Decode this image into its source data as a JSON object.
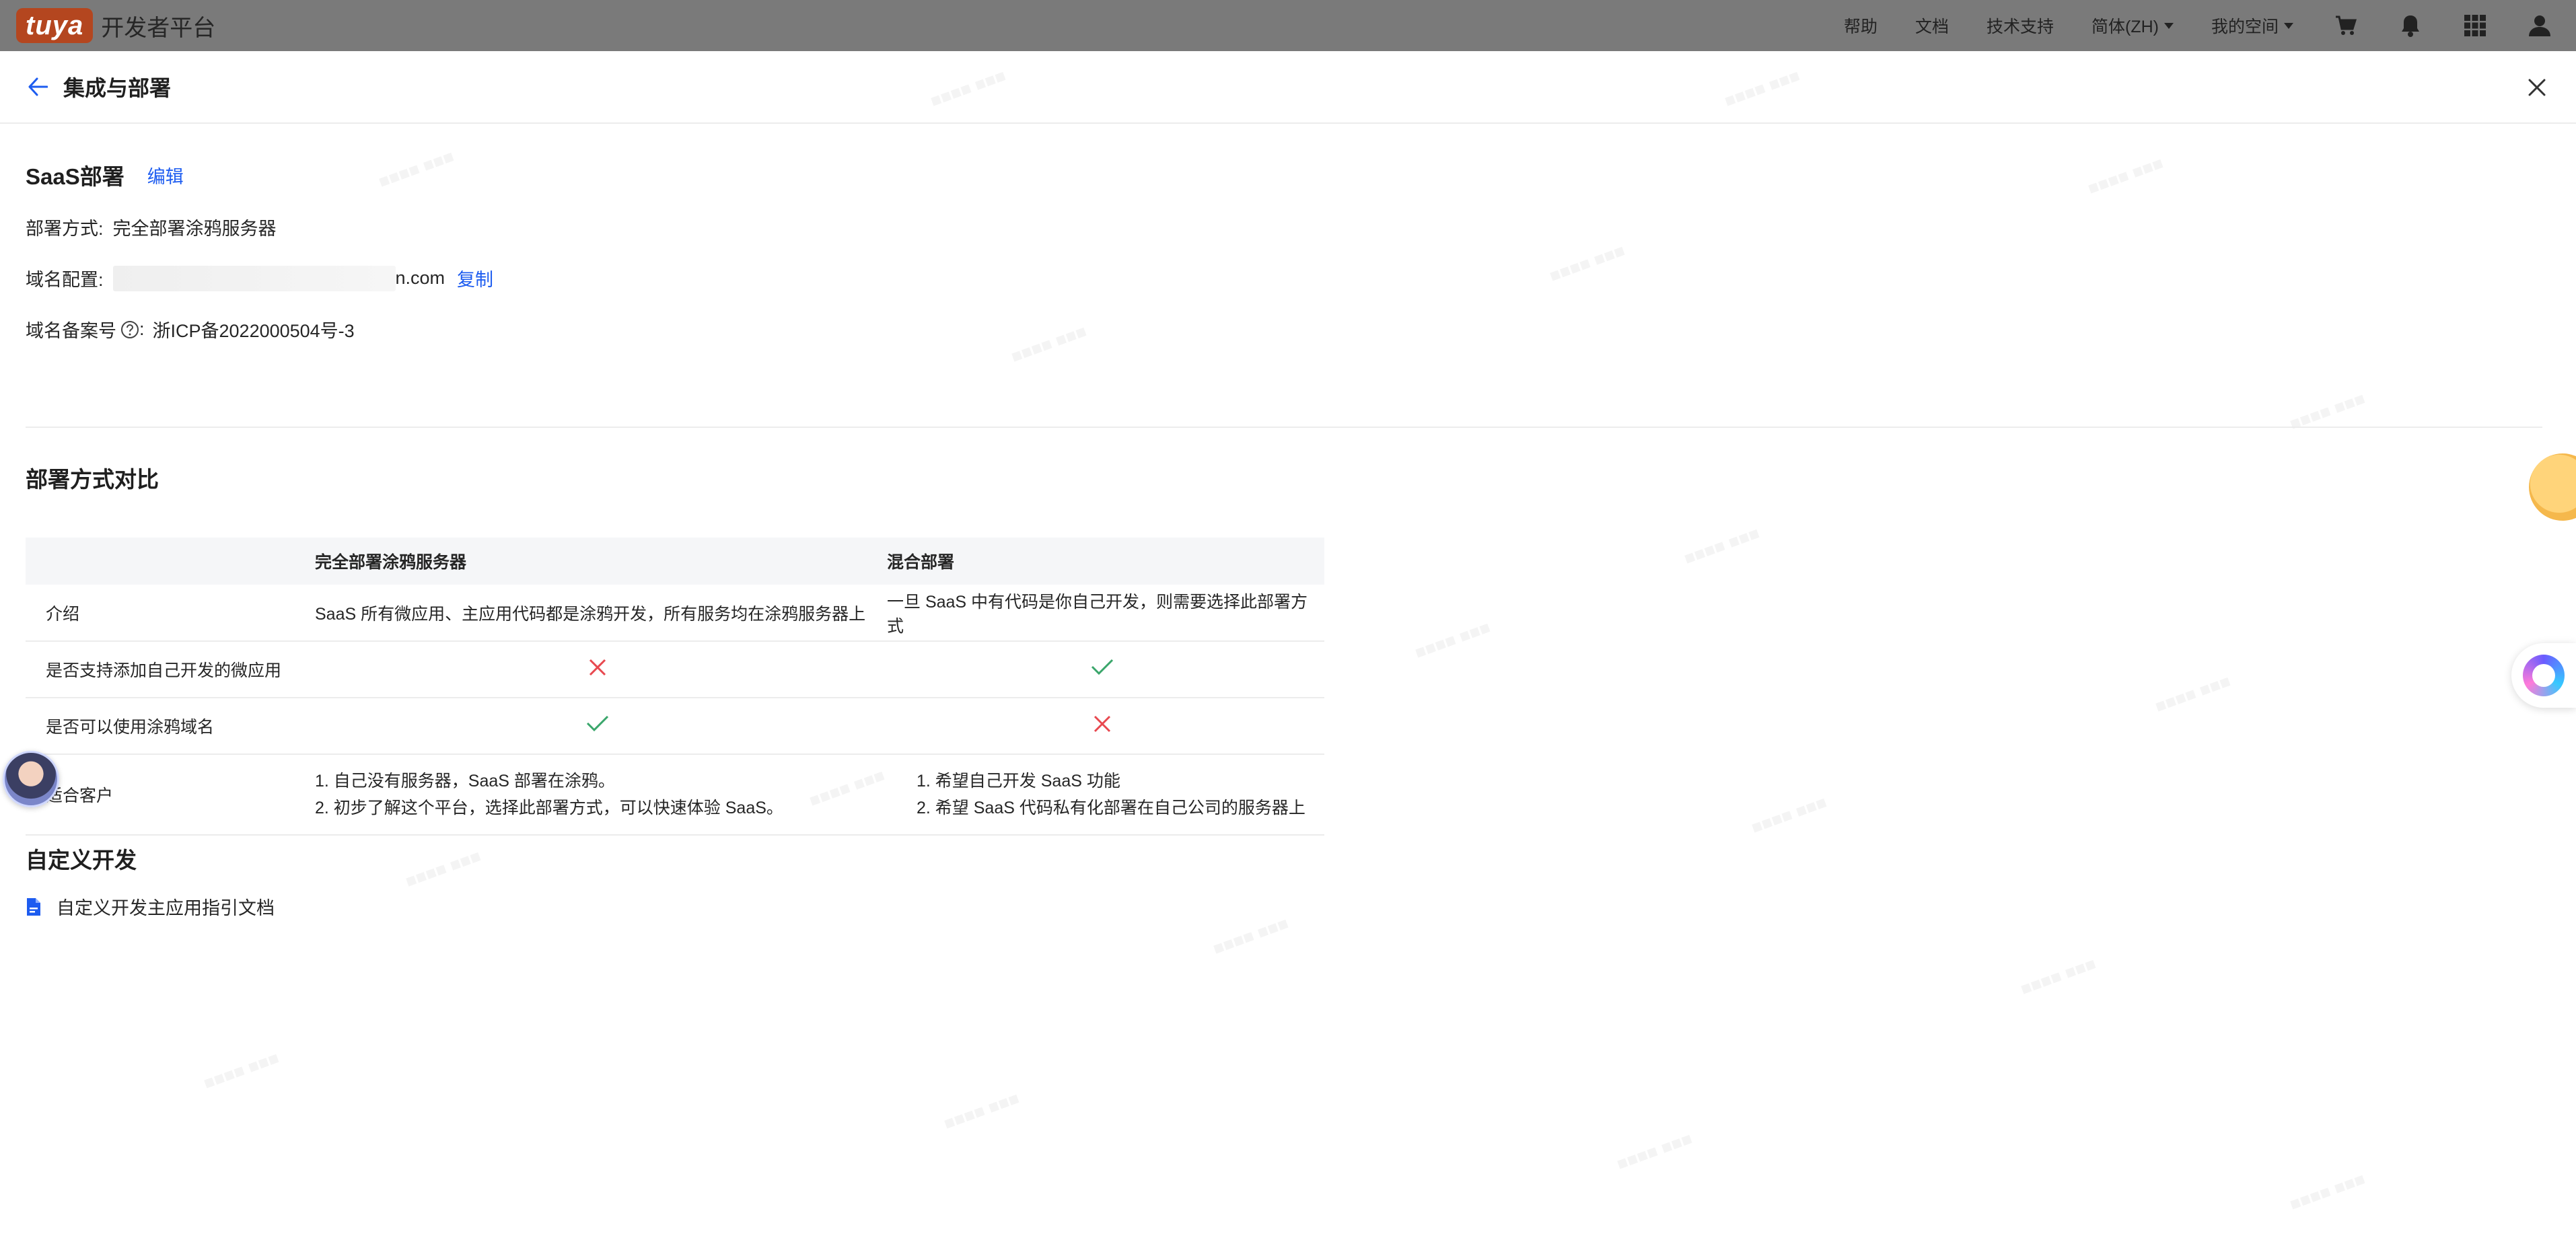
{
  "topbar": {
    "logo": "tuya",
    "platform": "开发者平台",
    "nav": {
      "help": "帮助",
      "docs": "文档",
      "support": "技术支持",
      "language": "简体(ZH)",
      "my_space": "我的空间"
    },
    "icons": [
      "cart-icon",
      "bell-icon",
      "apps-grid-icon",
      "user-icon"
    ]
  },
  "drawer": {
    "title": "集成与部署",
    "saas": {
      "title": "SaaS部署",
      "edit": "编辑",
      "method_label": "部署方式:",
      "method_value": "完全部署涂鸦服务器",
      "domain_label": "域名配置:",
      "domain_suffix": "n.com",
      "copy": "复制",
      "icp_label": "域名备案号",
      "icp_colon": ":",
      "icp_value": "浙ICP备2022000504号-3"
    },
    "compare": {
      "title": "部署方式对比",
      "headers": [
        "",
        "完全部署涂鸦服务器",
        "混合部署"
      ],
      "rows": {
        "intro": {
          "label": "介绍",
          "full": "SaaS 所有微应用、主应用代码都是涂鸦开发，所有服务均在涂鸦服务器上",
          "hybrid": "一旦 SaaS 中有代码是你自己开发，则需要选择此部署方式"
        },
        "custom_app": {
          "label": "是否支持添加自己开发的微应用",
          "full": "cross-icon",
          "hybrid": "check-icon"
        },
        "tuya_domain": {
          "label": "是否可以使用涂鸦域名",
          "full": "check-icon",
          "hybrid": "cross-icon"
        },
        "customers": {
          "label": "适合客户",
          "full_1": "1. 自己没有服务器，SaaS 部署在涂鸦。",
          "full_2": "2. 初步了解这个平台，选择此部署方式，可以快速体验 SaaS。",
          "hybrid_1": "1. 希望自己开发 SaaS 功能",
          "hybrid_2": "2. 希望 SaaS 代码私有化部署在自己公司的服务器上"
        }
      }
    },
    "custom": {
      "title": "自定义开发",
      "doc_link": "自定义开发主应用指引文档"
    }
  },
  "colors": {
    "accent": "#1d5cf0",
    "check": "#3aa66b",
    "cross": "#e8484f",
    "header_bg": "#f5f6f8",
    "overlay_topbar": "#7a7a7a"
  }
}
